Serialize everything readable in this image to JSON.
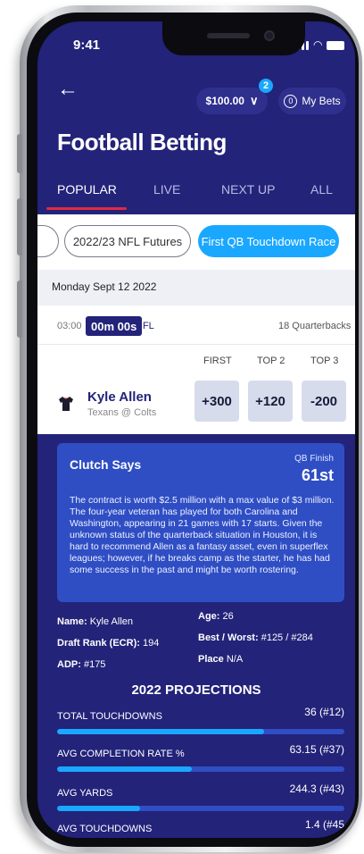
{
  "status_bar": {
    "time": "9:41"
  },
  "header": {
    "balance": "$100.00",
    "badge_count": "2",
    "my_bets_count": "0",
    "my_bets_label": "My Bets",
    "title": "Football Betting"
  },
  "tabs": [
    {
      "label": "POPULAR",
      "active": true
    },
    {
      "label": "LIVE",
      "active": false
    },
    {
      "label": "NEXT UP",
      "active": false
    },
    {
      "label": "ALL",
      "active": false
    }
  ],
  "filters": [
    {
      "label": "2022/23 NFL Futures",
      "active": false
    },
    {
      "label": "First QB Touchdown Race",
      "active": true
    }
  ],
  "event": {
    "date": "Monday Sept 12 2022",
    "time": "03:00",
    "countdown": "00m 00s",
    "league": "NFL",
    "count": "18 Quarterbacks",
    "columns": [
      "FIRST",
      "TOP 2",
      "TOP 3"
    ]
  },
  "player": {
    "name": "Kyle Allen",
    "matchup": "Texans @ Colts",
    "odds": [
      "+300",
      "+120",
      "-200"
    ]
  },
  "clutch": {
    "title": "Clutch Says",
    "finish_label": "QB Finish",
    "finish_value": "61st",
    "body": "The contract is worth $2.5 million with a max value of $3 million. The four-year veteran has played for both Carolina and Washington, appearing in 21 games with 17 starts. Given the unknown status of the quarterback situation in Houston, it is hard to recommend Allen as a fantasy asset, even in superflex leagues; however, if he breaks camp as the starter, he has had some success in the past and might be worth rostering."
  },
  "stats": {
    "name_label": "Name:",
    "name_value": "Kyle Allen",
    "draft_label": "Draft Rank (ECR):",
    "draft_value": "194",
    "adp_label": "ADP:",
    "adp_value": "#175",
    "age_label": "Age:",
    "age_value": "26",
    "best_label": "Best / Worst:",
    "best_value": "#125 / #284",
    "place_label": "Place",
    "place_value": "N/A"
  },
  "projections": {
    "title": "2022 PROJECTIONS",
    "items": [
      {
        "label": "TOTAL TOUCHDOWNS",
        "value": "36 (#12)",
        "fill": 0.72
      },
      {
        "label": "AVG COMPLETION RATE %",
        "value": "63.15 (#37)",
        "fill": 0.47
      },
      {
        "label": "AVG YARDS",
        "value": "244.3 (#43)",
        "fill": 0.29
      },
      {
        "label": "AVG TOUCHDOWNS",
        "value": "1.4 (#45",
        "fill": 0.2
      }
    ]
  },
  "colors": {
    "background": "#23237a",
    "accent": "#1aa7ff",
    "tab_underline": "#e12a3d",
    "card": "#2f4ec4"
  }
}
